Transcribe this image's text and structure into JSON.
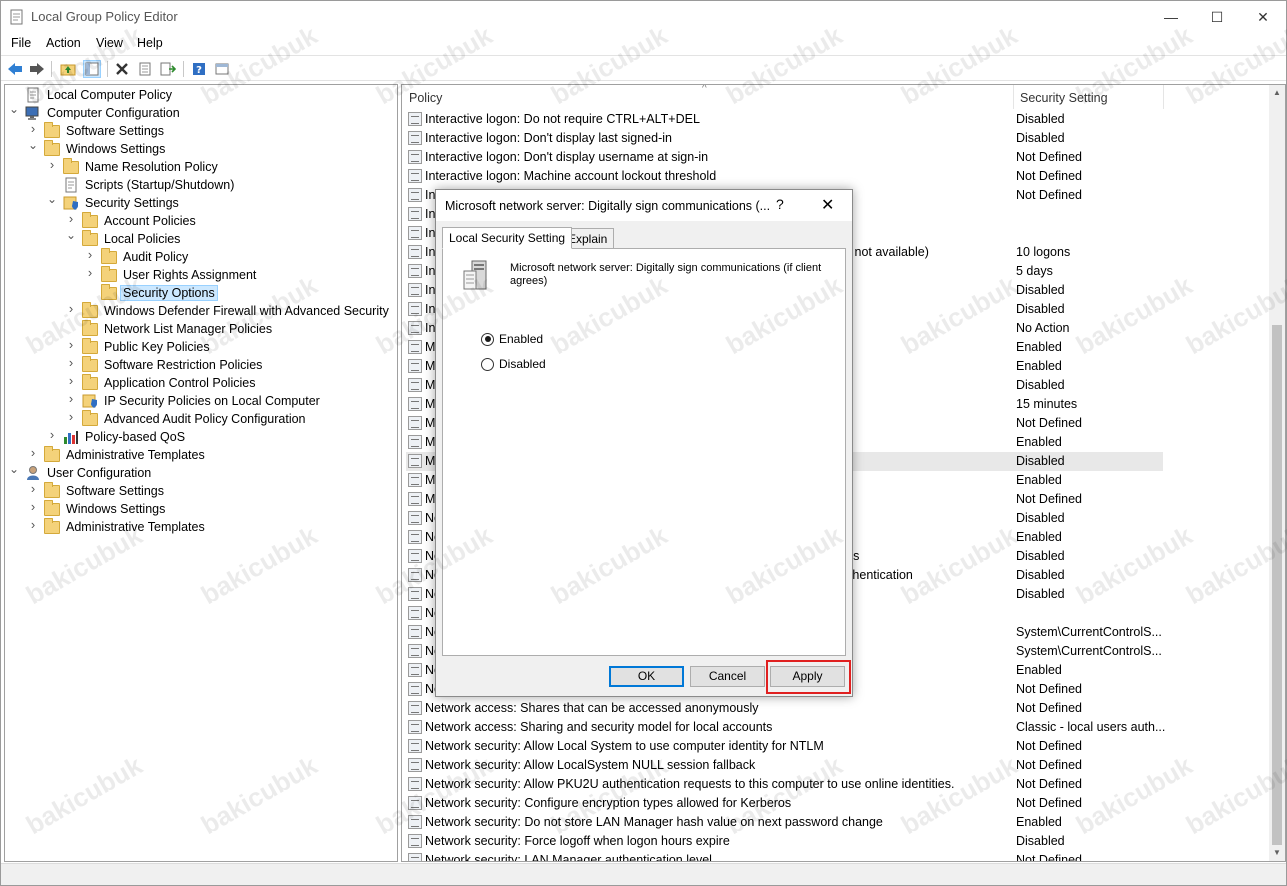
{
  "window": {
    "title": "Local Group Policy Editor",
    "minimize_glyph": "—",
    "maximize_glyph": "☐",
    "close_glyph": "✕"
  },
  "menu": [
    "File",
    "Action",
    "View",
    "Help"
  ],
  "toolbar_icons": [
    "back-arrow-icon",
    "forward-arrow-icon",
    "up-folder-icon",
    "show-hide-tree-icon",
    "delete-icon",
    "properties-icon",
    "export-list-icon",
    "help-icon",
    "view-icon"
  ],
  "tree": [
    {
      "label": "Local Computer Policy",
      "level": 0,
      "icon": "computer-policy-icon",
      "chevron": ""
    },
    {
      "label": "Computer Configuration",
      "level": 0,
      "icon": "computer-icon",
      "chevron": "v"
    },
    {
      "label": "Software Settings",
      "level": 1,
      "icon": "folder-icon",
      "chevron": ">"
    },
    {
      "label": "Windows Settings",
      "level": 1,
      "icon": "folder-icon",
      "chevron": "v"
    },
    {
      "label": "Name Resolution Policy",
      "level": 2,
      "icon": "folder-icon",
      "chevron": ">"
    },
    {
      "label": "Scripts (Startup/Shutdown)",
      "level": 2,
      "icon": "scripts-icon",
      "chevron": ""
    },
    {
      "label": "Security Settings",
      "level": 2,
      "icon": "security-settings-icon",
      "chevron": "v"
    },
    {
      "label": "Account Policies",
      "level": 3,
      "icon": "folder-icon",
      "chevron": ">"
    },
    {
      "label": "Local Policies",
      "level": 3,
      "icon": "folder-icon",
      "chevron": "v"
    },
    {
      "label": "Audit Policy",
      "level": 4,
      "icon": "folder-icon",
      "chevron": ">"
    },
    {
      "label": "User Rights Assignment",
      "level": 4,
      "icon": "folder-icon",
      "chevron": ">"
    },
    {
      "label": "Security Options",
      "level": 4,
      "icon": "folder-icon",
      "chevron": "",
      "selected": true
    },
    {
      "label": "Windows Defender Firewall with Advanced Security",
      "level": 3,
      "icon": "folder-icon",
      "chevron": ">"
    },
    {
      "label": "Network List Manager Policies",
      "level": 3,
      "icon": "folder-icon",
      "chevron": ""
    },
    {
      "label": "Public Key Policies",
      "level": 3,
      "icon": "folder-icon",
      "chevron": ">"
    },
    {
      "label": "Software Restriction Policies",
      "level": 3,
      "icon": "folder-icon",
      "chevron": ">"
    },
    {
      "label": "Application Control Policies",
      "level": 3,
      "icon": "folder-icon",
      "chevron": ">"
    },
    {
      "label": "IP Security Policies on Local Computer",
      "level": 3,
      "icon": "ip-security-icon",
      "chevron": ">"
    },
    {
      "label": "Advanced Audit Policy Configuration",
      "level": 3,
      "icon": "folder-icon",
      "chevron": ">"
    },
    {
      "label": "Policy-based QoS",
      "level": 2,
      "icon": "qos-chart-icon",
      "chevron": ">"
    },
    {
      "label": "Administrative Templates",
      "level": 1,
      "icon": "folder-icon",
      "chevron": ">"
    },
    {
      "label": "User Configuration",
      "level": 0,
      "icon": "user-icon",
      "chevron": "v"
    },
    {
      "label": "Software Settings",
      "level": 1,
      "icon": "folder-icon",
      "chevron": ">"
    },
    {
      "label": "Windows Settings",
      "level": 1,
      "icon": "folder-icon",
      "chevron": ">"
    },
    {
      "label": "Administrative Templates",
      "level": 1,
      "icon": "folder-icon",
      "chevron": ">"
    }
  ],
  "columns": {
    "policy": "Policy",
    "setting": "Security Setting"
  },
  "policies": [
    {
      "name": "Interactive logon: Do not require CTRL+ALT+DEL",
      "value": "Disabled"
    },
    {
      "name": "Interactive logon: Don't display last signed-in",
      "value": "Disabled"
    },
    {
      "name": "Interactive logon: Don't display username at sign-in",
      "value": "Not Defined"
    },
    {
      "name": "Interactive logon: Machine account lockout threshold",
      "value": "Not Defined"
    },
    {
      "name": "Inf",
      "value": "Not Defined"
    },
    {
      "name": "Int",
      "value": ""
    },
    {
      "name": "Int",
      "value": ""
    },
    {
      "name": "Int",
      "tail": "is not available)",
      "value": "10 logons"
    },
    {
      "name": "Int",
      "value": "5 days"
    },
    {
      "name": "Int",
      "tail": "n",
      "value": "Disabled"
    },
    {
      "name": "Int",
      "value": "Disabled"
    },
    {
      "name": "Int",
      "value": "No Action"
    },
    {
      "name": "Mi",
      "value": "Enabled"
    },
    {
      "name": "Mi",
      "value": "Enabled"
    },
    {
      "name": "Mi",
      "value": "Disabled"
    },
    {
      "name": "Mi",
      "tail": "n",
      "value": "15 minutes"
    },
    {
      "name": "Mi",
      "value": "Not Defined"
    },
    {
      "name": "Mi",
      "value": "Enabled"
    },
    {
      "name": "Mi",
      "value": "Disabled",
      "highlight": true
    },
    {
      "name": "Mi",
      "value": "Enabled"
    },
    {
      "name": "Mi",
      "value": "Not Defined"
    },
    {
      "name": "Ne",
      "value": "Disabled"
    },
    {
      "name": "Ne",
      "value": "Enabled"
    },
    {
      "name": "Ne",
      "tail": "res",
      "value": "Disabled"
    },
    {
      "name": "Ne",
      "tail": "uthentication",
      "value": "Disabled"
    },
    {
      "name": "Ne",
      "value": "Disabled"
    },
    {
      "name": "Ne",
      "value": ""
    },
    {
      "name": "Ne",
      "value": "System\\CurrentControlS..."
    },
    {
      "name": "Ne",
      "value": "System\\CurrentControlS..."
    },
    {
      "name": "Ne",
      "value": "Enabled"
    },
    {
      "name": "Ne",
      "value": "Not Defined"
    },
    {
      "name": "Network access: Shares that can be accessed anonymously",
      "value": "Not Defined"
    },
    {
      "name": "Network access: Sharing and security model for local accounts",
      "value": "Classic - local users auth..."
    },
    {
      "name": "Network security: Allow Local System to use computer identity for NTLM",
      "value": "Not Defined"
    },
    {
      "name": "Network security: Allow LocalSystem NULL session fallback",
      "value": "Not Defined"
    },
    {
      "name": "Network security: Allow PKU2U authentication requests to this computer to use online identities.",
      "value": "Not Defined"
    },
    {
      "name": "Network security: Configure encryption types allowed for Kerberos",
      "value": "Not Defined"
    },
    {
      "name": "Network security: Do not store LAN Manager hash value on next password change",
      "value": "Enabled"
    },
    {
      "name": "Network security: Force logoff when logon hours expire",
      "value": "Disabled"
    },
    {
      "name": "Network security: LAN Manager authentication level",
      "value": "Not Defined"
    }
  ],
  "dialog": {
    "title": "Microsoft network server: Digitally sign communications (...",
    "help_glyph": "?",
    "close_glyph": "✕",
    "tabs": [
      "Local Security Setting",
      "Explain"
    ],
    "description": "Microsoft network server: Digitally sign communications (if client agrees)",
    "options": {
      "enabled": "Enabled",
      "disabled": "Disabled",
      "selected": "enabled"
    },
    "buttons": {
      "ok": "OK",
      "cancel": "Cancel",
      "apply": "Apply"
    }
  },
  "watermark": "bakicubuk",
  "colors": {
    "selection": "#cce8ff",
    "apply_highlight": "#e02020",
    "default_button": "#0078d7"
  }
}
